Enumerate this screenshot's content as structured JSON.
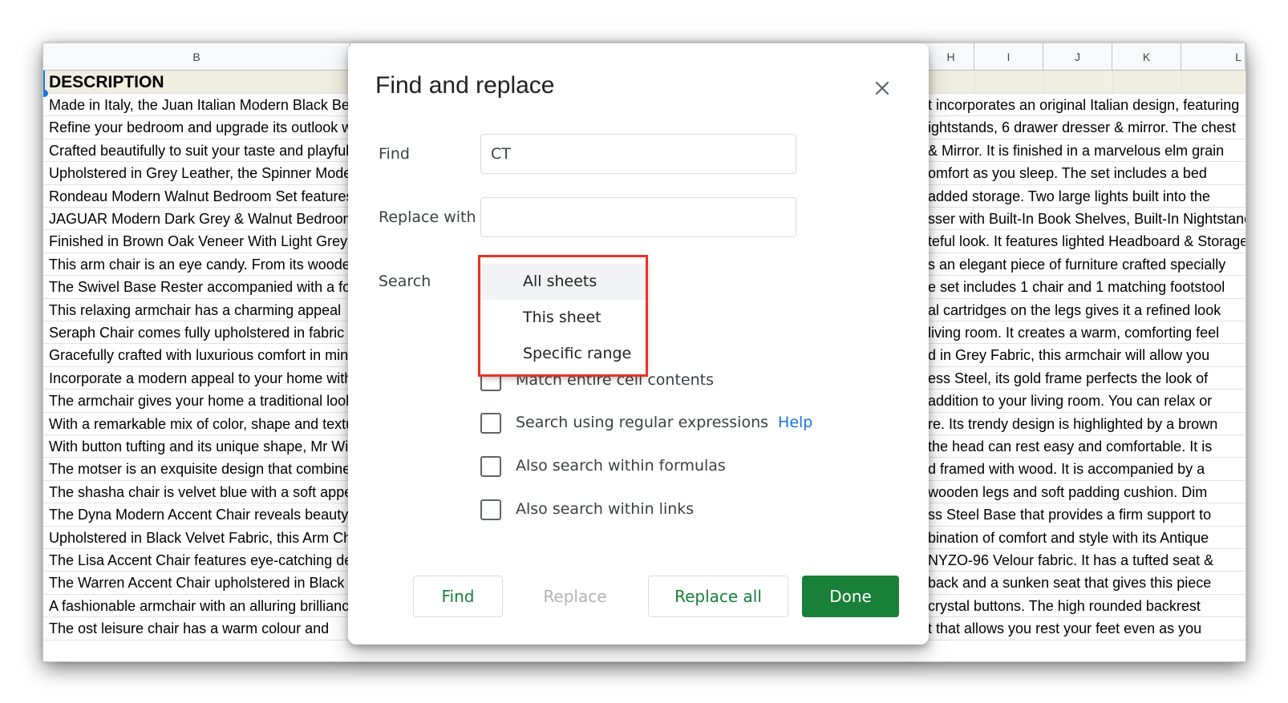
{
  "sheet": {
    "column_b_header": "B",
    "right_columns": [
      "H",
      "I",
      "J",
      "K",
      "L"
    ],
    "header_cell": "DESCRIPTION",
    "rows": [
      {
        "b": "Made in Italy, the Juan Italian Modern Black Bedroom Set",
        "r": "t incorporates an original Italian design, featuring"
      },
      {
        "b": "Refine your bedroom and upgrade its outlook with this set",
        "r": "ightstands, 6 drawer dresser & mirror. The chest"
      },
      {
        "b": "Crafted beautifully to suit your taste and playful style",
        "r": "& Mirror. It is finished in a marvelous elm grain"
      },
      {
        "b": "Upholstered in Grey Leather, the Spinner Modern Bed",
        "r": "omfort as you sleep. The set includes a bed"
      },
      {
        "b": "Rondeau Modern Walnut Bedroom Set features a storage",
        "r": "added storage. Two large lights built into the"
      },
      {
        "b": "JAGUAR Modern Dark Grey & Walnut Bedroom Set",
        "r": "sser with Built-In Book Shelves, Built-In Nightstands"
      },
      {
        "b": "Finished in Brown Oak Veneer With Light Grey",
        "r": "teful look. It features lighted Headboard & Storage"
      },
      {
        "b": "This arm chair is an eye candy. From its wooden",
        "r": "s an elegant piece of furniture crafted specially"
      },
      {
        "b": "The Swivel Base Rester accompanied with a footstool",
        "r": "e set includes 1 chair and 1 matching footstool"
      },
      {
        "b": "This relaxing armchair has a charming appeal",
        "r": "al cartridges on the legs gives it a refined look"
      },
      {
        "b": "Seraph Chair comes fully upholstered in fabric",
        "r": "living room. It creates a warm, comforting feel"
      },
      {
        "b": "Gracefully crafted with luxurious comfort in mind",
        "r": "d in Grey Fabric, this armchair will allow you"
      },
      {
        "b": "Incorporate a modern appeal to your home with",
        "r": "ess Steel, its gold frame perfects the look of"
      },
      {
        "b": "The armchair gives your home a traditional look",
        "r": "addition to your living room. You can relax or"
      },
      {
        "b": "With a remarkable mix of color, shape and texture",
        "r": "re. Its trendy design is highlighted by a brown"
      },
      {
        "b": "With button tufting and its unique shape, Mr Wing",
        "r": "the head can rest easy and comfortable. It is"
      },
      {
        "b": "The motser is an exquisite design that combines",
        "r": "d framed with wood. It is accompanied by a"
      },
      {
        "b": "The shasha chair is velvet blue with a soft appeal",
        "r": "wooden legs and soft padding cushion. Dim"
      },
      {
        "b": "The Dyna Modern Accent Chair reveals beauty",
        "r": "ss Steel Base that provides a firm support to"
      },
      {
        "b": "Upholstered in Black Velvet Fabric, this Arm Chair",
        "r": "bination of comfort and style with its Antique"
      },
      {
        "b": "The Lisa Accent Chair features eye-catching design",
        "r": "NYZO-96 Velour fabric. It has a tufted seat &"
      },
      {
        "b": "The Warren Accent Chair upholstered in Black",
        "r": "back and a sunken seat that gives this piece"
      },
      {
        "b": "A fashionable armchair with an alluring brilliance",
        "r": "crystal buttons. The high rounded backrest"
      },
      {
        "b": "The ost leisure chair has a warm colour and",
        "r": "t that allows you rest your feet even as you"
      }
    ]
  },
  "dialog": {
    "title": "Find and replace",
    "find_label": "Find",
    "find_value": "CT",
    "replace_label": "Replace with",
    "replace_value": "",
    "search_label": "Search",
    "search_options": [
      "All sheets",
      "This sheet",
      "Specific range"
    ],
    "selected_option": "All sheets",
    "checkboxes": [
      {
        "label": "Match entire cell contents",
        "checked": false
      },
      {
        "label": "Search using regular expressions",
        "checked": false,
        "help": "Help"
      },
      {
        "label": "Also search within formulas",
        "checked": false
      },
      {
        "label": "Also search within links",
        "checked": false
      }
    ],
    "buttons": {
      "find": "Find",
      "replace": "Replace",
      "replace_all": "Replace all",
      "done": "Done"
    }
  },
  "colors": {
    "accent_green": "#188038",
    "highlight_red": "#ea3323",
    "link_blue": "#1a73e8",
    "header_cell_bg": "#efeee0"
  }
}
